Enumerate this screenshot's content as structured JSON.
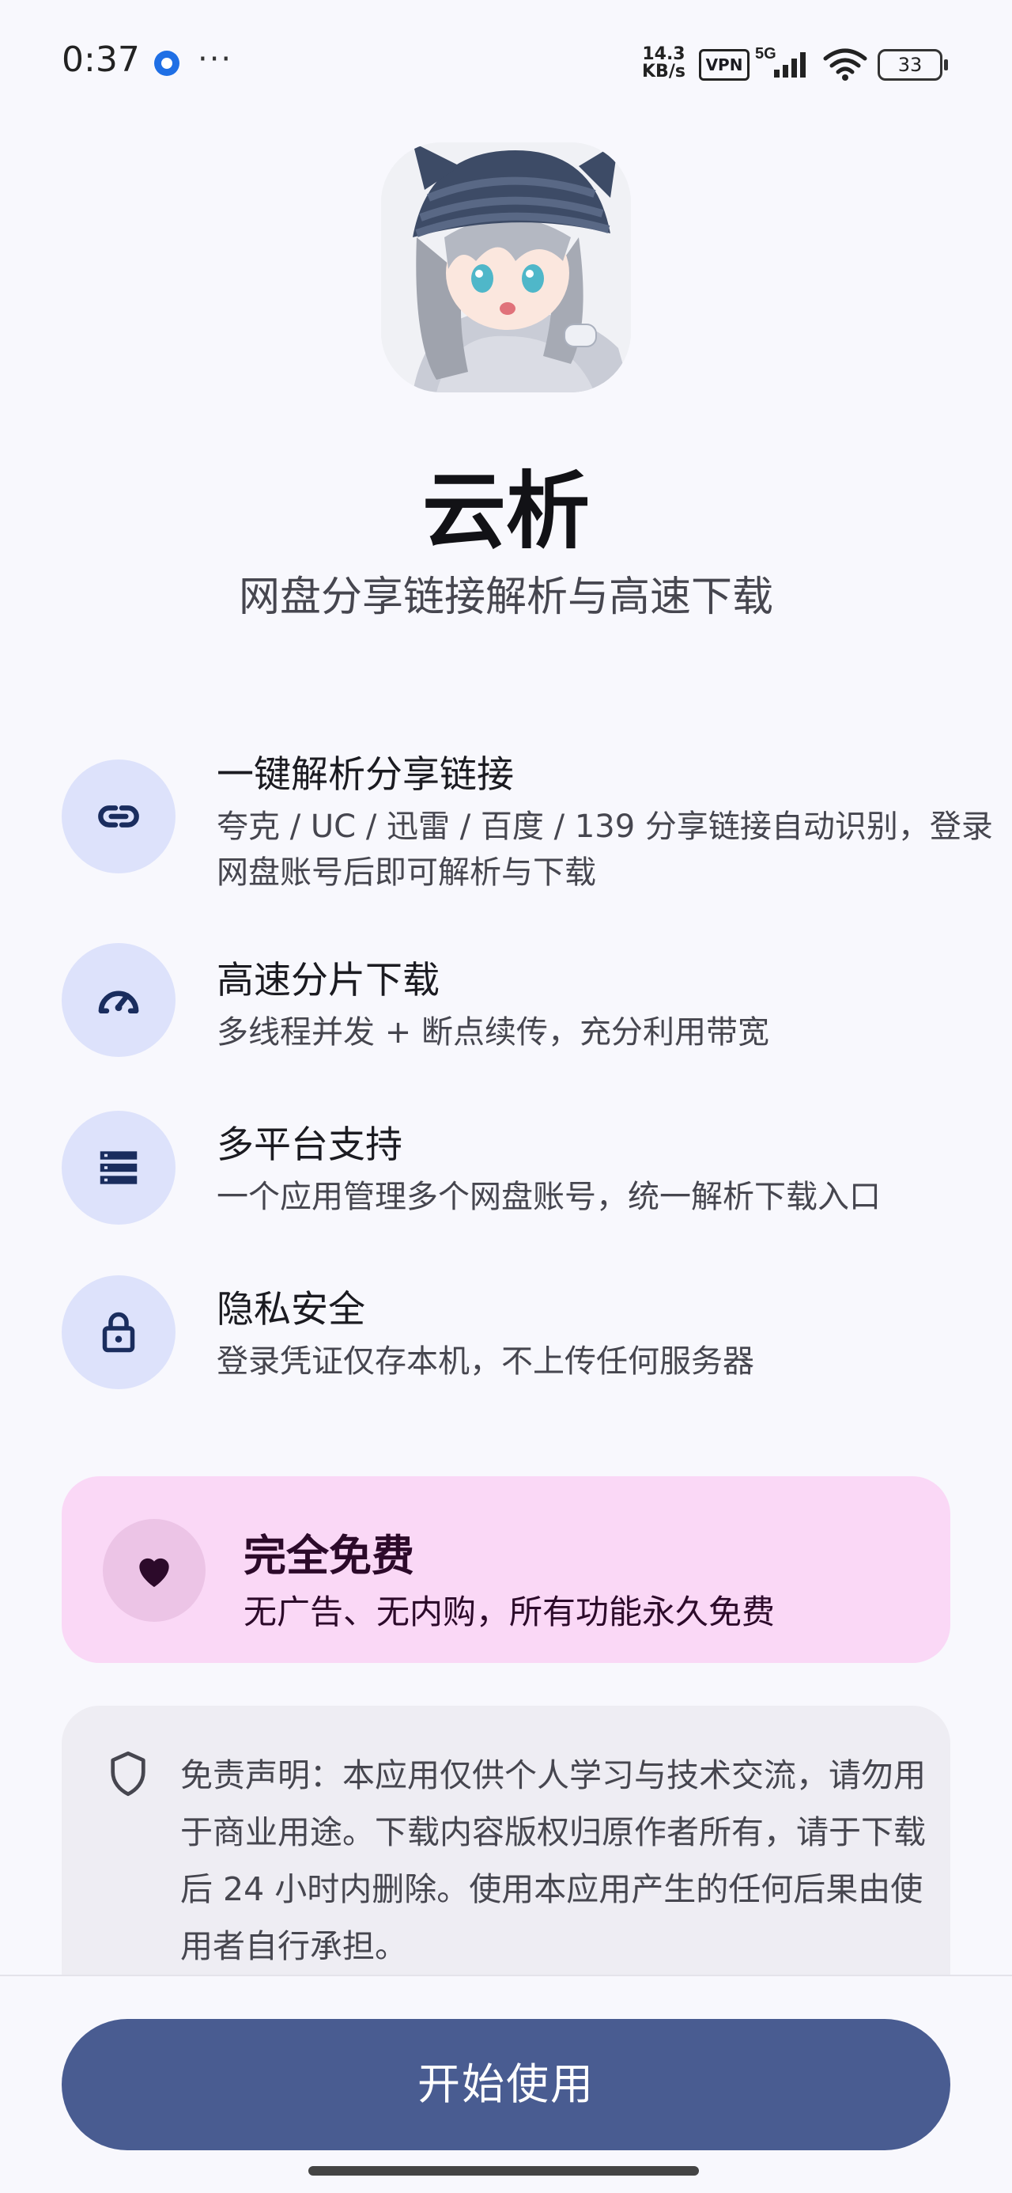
{
  "status_bar": {
    "time": "0:37",
    "net_speed_value": "14.3",
    "net_speed_unit": "KB/s",
    "vpn": "VPN",
    "network": "5G",
    "battery": "33",
    "more": "···",
    "icons": [
      "notification-dot-icon",
      "signal-icon",
      "wifi-icon",
      "battery-icon"
    ]
  },
  "header": {
    "app_name": "云析",
    "tagline": "网盘分享链接解析与高速下载"
  },
  "features": [
    {
      "icon": "link-icon",
      "title": "一键解析分享链接",
      "desc": "夸克 / UC / 迅雷 / 百度 / 139 分享链接自动识别，登录网盘账号后即可解析与下载"
    },
    {
      "icon": "speedometer-icon",
      "title": "高速分片下载",
      "desc": "多线程并发 + 断点续传，充分利用带宽"
    },
    {
      "icon": "storage-icon",
      "title": "多平台支持",
      "desc": "一个应用管理多个网盘账号，统一解析下载入口"
    },
    {
      "icon": "lock-icon",
      "title": "隐私安全",
      "desc": "登录凭证仅存本机，不上传任何服务器"
    }
  ],
  "free_card": {
    "icon": "heart-icon",
    "title": "完全免费",
    "desc": "无广告、无内购，所有功能永久免费"
  },
  "disclaimer": {
    "icon": "shield-icon",
    "text": "免责声明：本应用仅供个人学习与技术交流，请勿用于商业用途。下载内容版权归原作者所有，请于下载后 24 小时内删除。使用本应用产生的任何后果由使用者自行承担。"
  },
  "start_button": {
    "label": "开始使用"
  },
  "colors": {
    "background": "#f8f8fd",
    "feature_icon_bg": "#dde2fb",
    "feature_icon_fg": "#1a2d5e",
    "free_card_bg": "#fad8f6",
    "free_icon_bg": "#ecc4e6",
    "free_fg": "#2c0a2a",
    "disclaimer_bg": "#eeedf3",
    "primary_button": "#495c91"
  }
}
